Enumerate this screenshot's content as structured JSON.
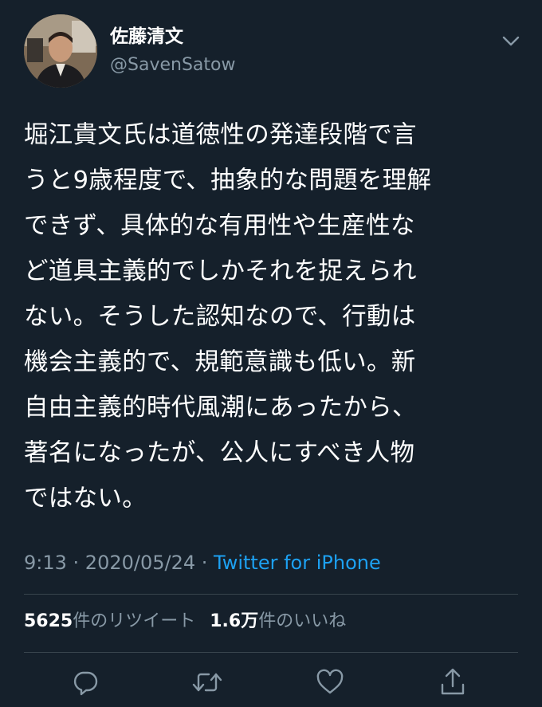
{
  "user": {
    "display_name": "佐藤清文",
    "handle": "@SavenSatow"
  },
  "tweet": {
    "text": "堀江貴文氏は道徳性の発達段階で言\nうと9歳程度で、抽象的な問題を理解\nできず、具体的な有用性や生産性な\nど道具主義的でしかそれを捉えられ\nない。そうした認知なので、行動は\n機会主義的で、規範意識も低い。新\n自由主義的時代風潮にあったから、\n著名になったが、公人にすべき人物\nではない。",
    "time": "9:13",
    "separator1": " · ",
    "date": "2020/05/24",
    "separator2": " · ",
    "source": "Twitter for iPhone"
  },
  "stats": {
    "retweets_count": "5625",
    "retweets_label": "件のリツイート",
    "likes_count": "1.6万",
    "likes_label": "件のいいね"
  },
  "icons": {
    "caret": "chevron-down-icon",
    "reply": "reply-icon",
    "retweet": "retweet-icon",
    "like": "heart-icon",
    "share": "share-icon"
  },
  "colors": {
    "background": "#15202b",
    "secondary_text": "#8899a6",
    "link": "#1da1f2",
    "divider": "#38444d"
  }
}
